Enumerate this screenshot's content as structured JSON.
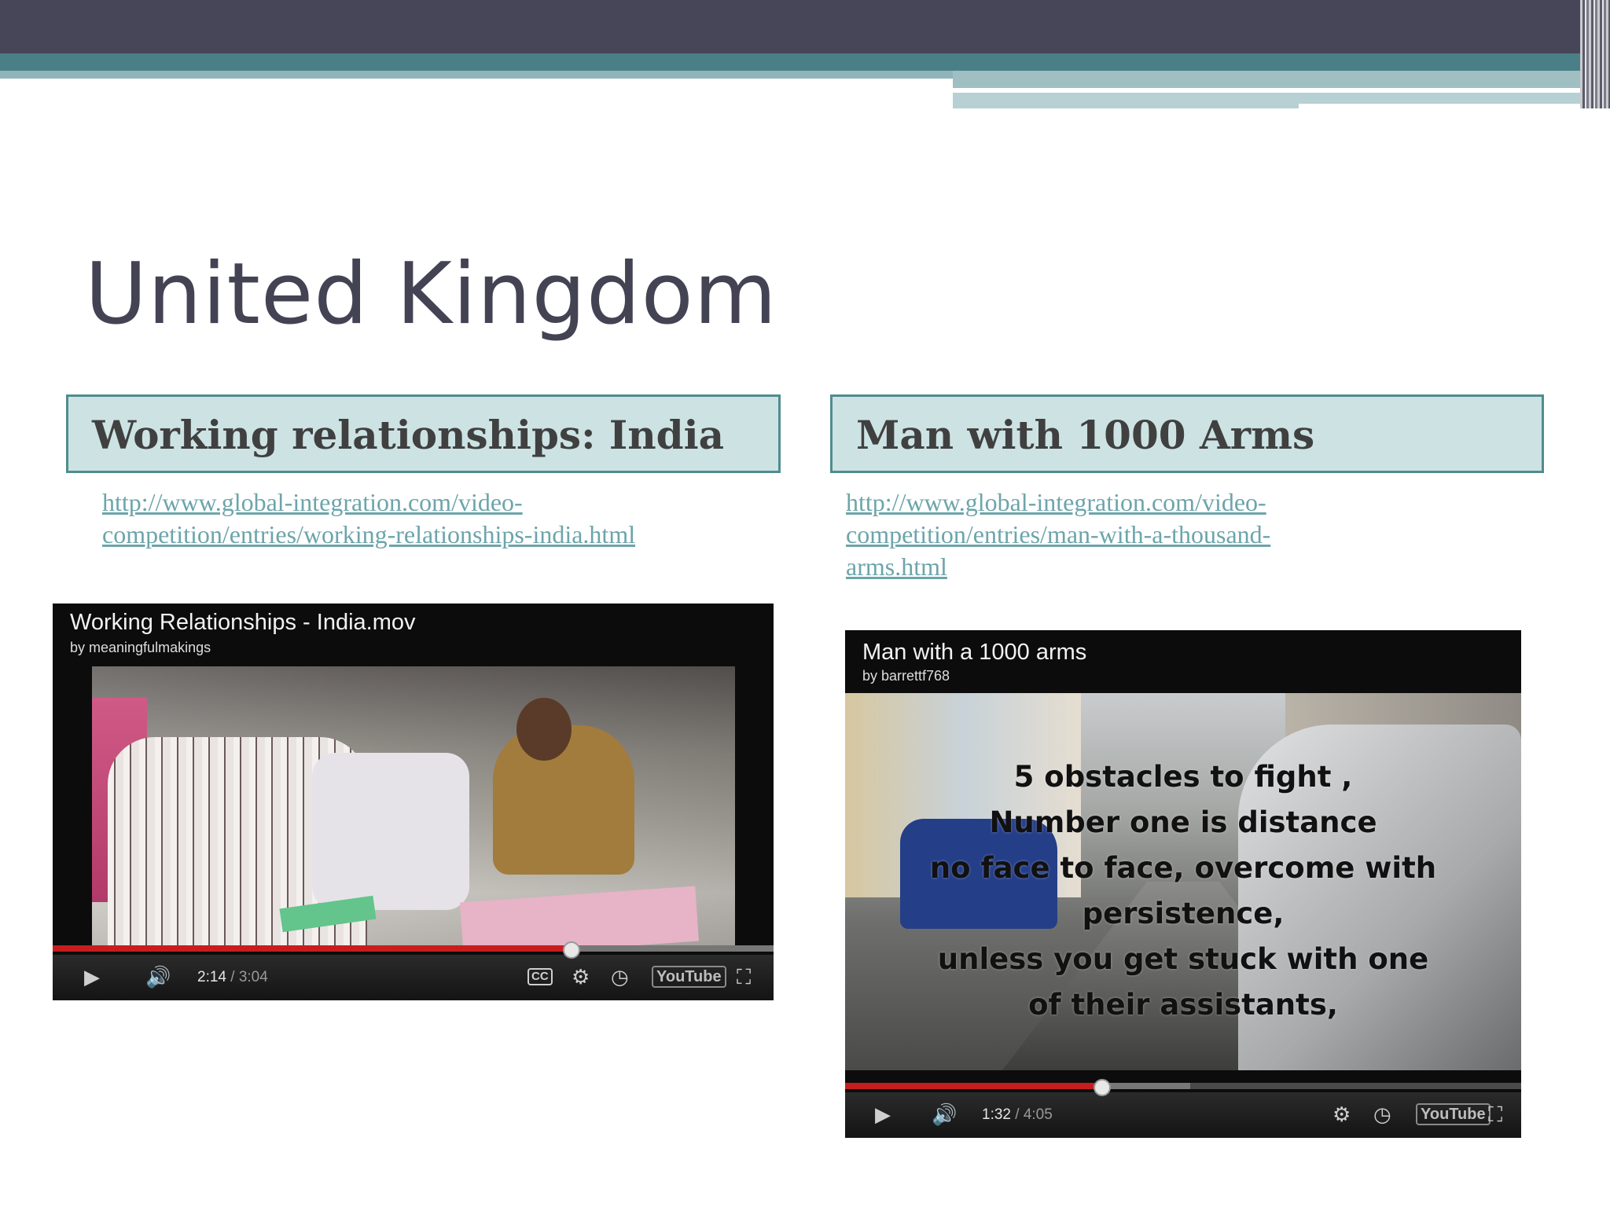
{
  "slide": {
    "title": "United Kingdom"
  },
  "columns": [
    {
      "header": "Working relationships: India",
      "link_lines": [
        "http://www.global-integration.com/video-",
        "competition/entries/working-relationships-india.html"
      ],
      "video": {
        "title": "Working Relationships - India.mov",
        "byline": "by meaningfulmakings",
        "time_current": "2:14",
        "time_total": "/ 3:04",
        "progress_fraction": 0.72,
        "buffered_fraction": 1.0
      }
    },
    {
      "header": "Man with 1000 Arms",
      "link_lines": [
        "http://www.global-integration.com/video-",
        "competition/entries/man-with-a-thousand-",
        "arms.html"
      ],
      "video": {
        "title": "Man with a 1000 arms",
        "byline": "by barrettf768",
        "overlay_lines": [
          "5 obstacles to fight ,",
          "Number one is distance",
          "no face to face, overcome with",
          "persistence,",
          "unless you get stuck with one",
          "of their assistants,"
        ],
        "time_current": "1:32",
        "time_total": "/ 4:05",
        "progress_fraction": 0.38,
        "buffered_fraction": 0.51
      }
    }
  ],
  "player": {
    "youtube_logo": "YouTube",
    "cc_label": "CC",
    "icons": [
      "play-icon",
      "volume-icon",
      "gear-icon",
      "clock-icon",
      "fullscreen-icon"
    ]
  },
  "colors": {
    "header_dark": "#464658",
    "header_teal": "#4a7f87",
    "box_fill": "#cde3e3",
    "box_border": "#4f8c8f",
    "link": "#6ca5aa",
    "progress_played": "#c81d1d"
  }
}
